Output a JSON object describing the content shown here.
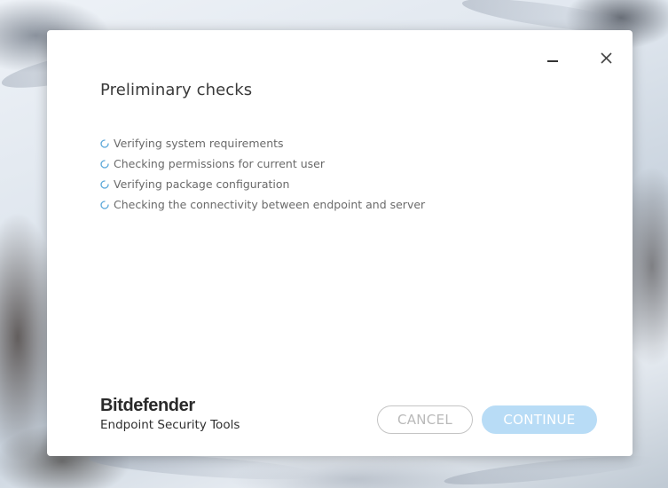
{
  "window": {
    "minimize_label": "Minimize",
    "close_label": "Close"
  },
  "dialog": {
    "title": "Preliminary checks",
    "checks": [
      {
        "label": "Verifying system requirements",
        "status": "in-progress"
      },
      {
        "label": "Checking permissions for current user",
        "status": "in-progress"
      },
      {
        "label": "Verifying package configuration",
        "status": "in-progress"
      },
      {
        "label": "Checking the connectivity between endpoint and server",
        "status": "in-progress"
      }
    ],
    "brand": {
      "name": "Bitdefender",
      "product": "Endpoint Security Tools"
    },
    "buttons": {
      "cancel": "CANCEL",
      "continue": "CONTINUE"
    }
  },
  "colors": {
    "accent_spinner": "#5ba8d9",
    "continue_bg": "#b8dcf6",
    "cancel_border": "#c4c4c4",
    "cancel_text": "#b9b9b9"
  },
  "icons": {
    "spinner": "loading-spinner-icon",
    "minimize": "minimize-icon",
    "close": "close-icon"
  }
}
